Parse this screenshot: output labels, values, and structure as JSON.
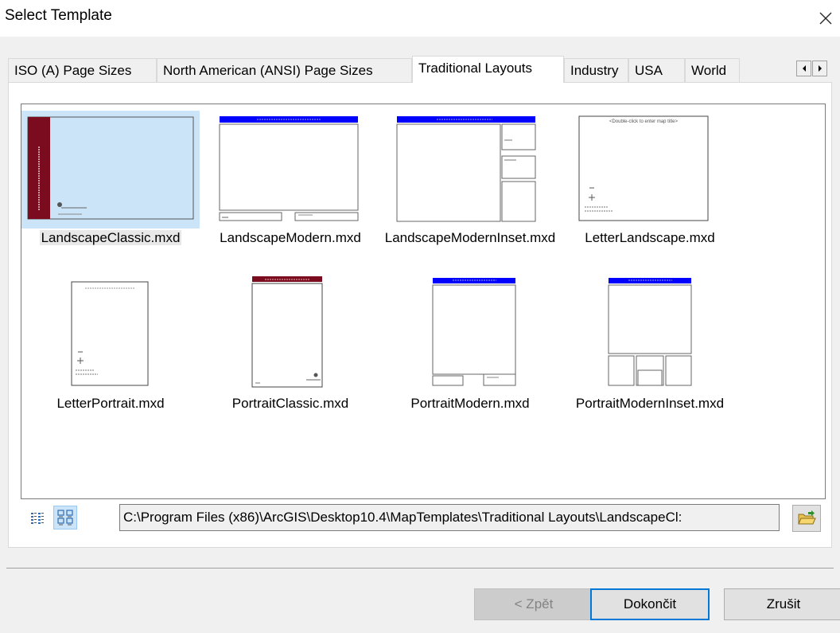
{
  "window": {
    "title": "Select Template"
  },
  "tabs": [
    {
      "label": "ISO (A) Page Sizes"
    },
    {
      "label": "North American (ANSI) Page Sizes"
    },
    {
      "label": "Traditional Layouts"
    },
    {
      "label": "Industry"
    },
    {
      "label": "USA"
    },
    {
      "label": "World"
    }
  ],
  "active_tab": "Traditional Layouts",
  "templates": [
    {
      "label": "LandscapeClassic.mxd",
      "selected": true
    },
    {
      "label": "LandscapeModern.mxd"
    },
    {
      "label": "LandscapeModernInset.mxd"
    },
    {
      "label": "LetterLandscape.mxd"
    },
    {
      "label": "LetterPortrait.mxd"
    },
    {
      "label": "PortraitClassic.mxd"
    },
    {
      "label": "PortraitModern.mxd"
    },
    {
      "label": "PortraitModernInset.mxd"
    }
  ],
  "thumb_text": {
    "double_click": "<Double-click to enter map title>"
  },
  "path": {
    "value": "C:\\Program Files (x86)\\ArcGIS\\Desktop10.4\\MapTemplates\\Traditional Layouts\\LandscapeCl:"
  },
  "buttons": {
    "back": "< Zpět",
    "finish": "Dokončit",
    "cancel": "Zrušit"
  },
  "icons": {
    "close": "close-icon",
    "list_view": "list-view-icon",
    "thumbnail_view": "thumbnail-view-icon",
    "browse": "open-folder-icon",
    "scroll_left": "arrow-left-icon",
    "scroll_right": "arrow-right-icon"
  },
  "colors": {
    "modern_banner": "#0000ff",
    "classic_banner": "#7b0b1e",
    "selection": "#cce4f7",
    "accent": "#0078d7"
  }
}
